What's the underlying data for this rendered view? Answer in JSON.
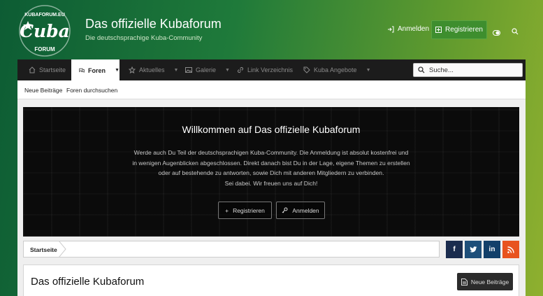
{
  "header": {
    "logo_text_top": "KUBAFORUM.EU",
    "logo_text_main": "Cuba",
    "logo_text_bottom": "FORUM",
    "title": "Das offizielle Kubaforum",
    "description": "Die deutschsprachige Kuba-Community",
    "login_label": "Anmelden",
    "register_label": "Registrieren"
  },
  "nav": {
    "items": [
      {
        "label": "Startseite",
        "icon": "home-icon"
      },
      {
        "label": "Foren",
        "icon": "chat-icon",
        "active": true
      },
      {
        "label": "Aktuelles",
        "icon": "star-icon"
      },
      {
        "label": "Galerie",
        "icon": "image-icon"
      },
      {
        "label": "Link Verzeichnis",
        "icon": "link-icon"
      },
      {
        "label": "Kuba Angebote",
        "icon": "tag-icon"
      }
    ],
    "search_placeholder": "Suche..."
  },
  "subnav": {
    "items": [
      "Neue Beiträge",
      "Foren durchsuchen"
    ]
  },
  "banner": {
    "title": "Willkommen auf Das offizielle Kubaforum",
    "lines": [
      "Werde auch Du Teil der deutschsprachigen Kuba-Community. Die Anmeldung ist absolut kostenfrei und",
      "in wenigen Augenblicken abgeschlossen. Direkt danach bist Du in der Lage, eigene Themen zu erstellen",
      "oder auf bestehende zu antworten, sowie Dich mit anderen Mitgliedern zu verbinden.",
      "Sei dabei. Wir freuen uns auf Dich!"
    ],
    "register_label": "Registrieren",
    "login_label": "Anmelden"
  },
  "breadcrumb": {
    "items": [
      "Startseite"
    ]
  },
  "social": [
    {
      "name": "facebook",
      "glyph": "f",
      "color": "#1a2c4e"
    },
    {
      "name": "twitter",
      "glyph": "t",
      "color": "#1e4f7a"
    },
    {
      "name": "linkedin",
      "glyph": "in",
      "color": "#12406a"
    },
    {
      "name": "rss",
      "glyph": "rss",
      "color": "#e8531e"
    }
  ],
  "forum": {
    "title": "Das offizielle Kubaforum",
    "new_posts_label": "Neue Beiträge"
  },
  "colors": {
    "accent_green": "#3e8e2e",
    "navbar_bg": "#1c1c1c",
    "banner_bg": "#0b0b0b"
  }
}
